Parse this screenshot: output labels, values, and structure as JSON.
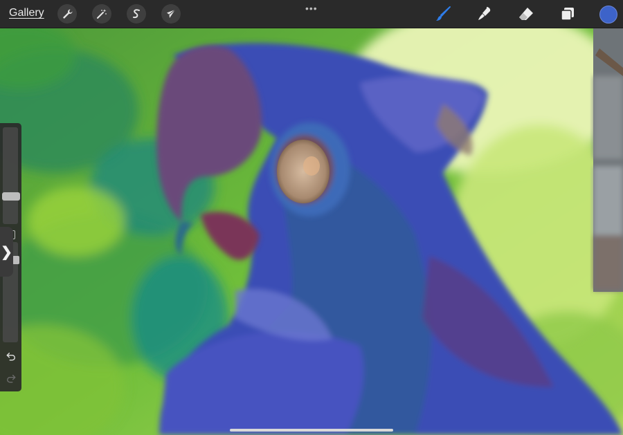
{
  "toolbar": {
    "gallery_label": "Gallery",
    "actions_icon": "wrench-icon",
    "adjustments_icon": "magic-wand-icon",
    "selection_icon": "selection-s-icon",
    "transform_icon": "arrow-cursor-icon",
    "more_label": "•••",
    "brush_icon": "paintbrush-icon",
    "smudge_icon": "smudge-finger-icon",
    "eraser_icon": "eraser-icon",
    "layers_icon": "layers-icon",
    "active_color": "#3d63c9",
    "brush_active_color": "#2f7dea"
  },
  "sidebar": {
    "toggle_label": "❯",
    "undo_icon": "undo-icon",
    "redo_icon": "redo-icon"
  }
}
